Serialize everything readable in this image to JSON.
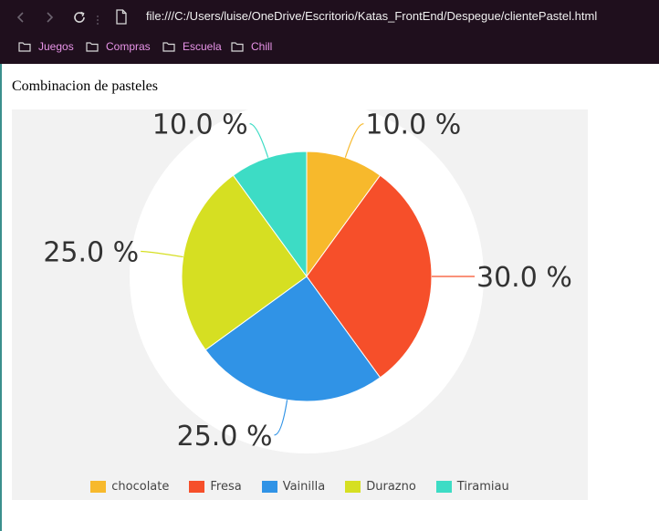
{
  "browser": {
    "url": "file:///C:/Users/luise/OneDrive/Escritorio/Katas_FrontEnd/Despegue/clientePastel.html",
    "bookmarks": [
      {
        "label": "Juegos"
      },
      {
        "label": "Compras"
      },
      {
        "label": "Escuela"
      },
      {
        "label": "Chill"
      }
    ]
  },
  "page": {
    "title": "Combinacion de pasteles"
  },
  "chart_data": {
    "type": "pie",
    "categories": [
      "chocolate",
      "Fresa",
      "Vainilla",
      "Durazno",
      "Tiramiau"
    ],
    "values": [
      10.0,
      30.0,
      25.0,
      25.0,
      10.0
    ],
    "labels": [
      "10.0 %",
      "30.0 %",
      "25.0 %",
      "25.0 %",
      "10.0 %"
    ],
    "colors": [
      "#f7b92c",
      "#f64f2a",
      "#3093e6",
      "#d6df22",
      "#3ddcc5"
    ],
    "legend_position": "bottom",
    "start_angle_deg": 90,
    "direction": "clockwise"
  }
}
